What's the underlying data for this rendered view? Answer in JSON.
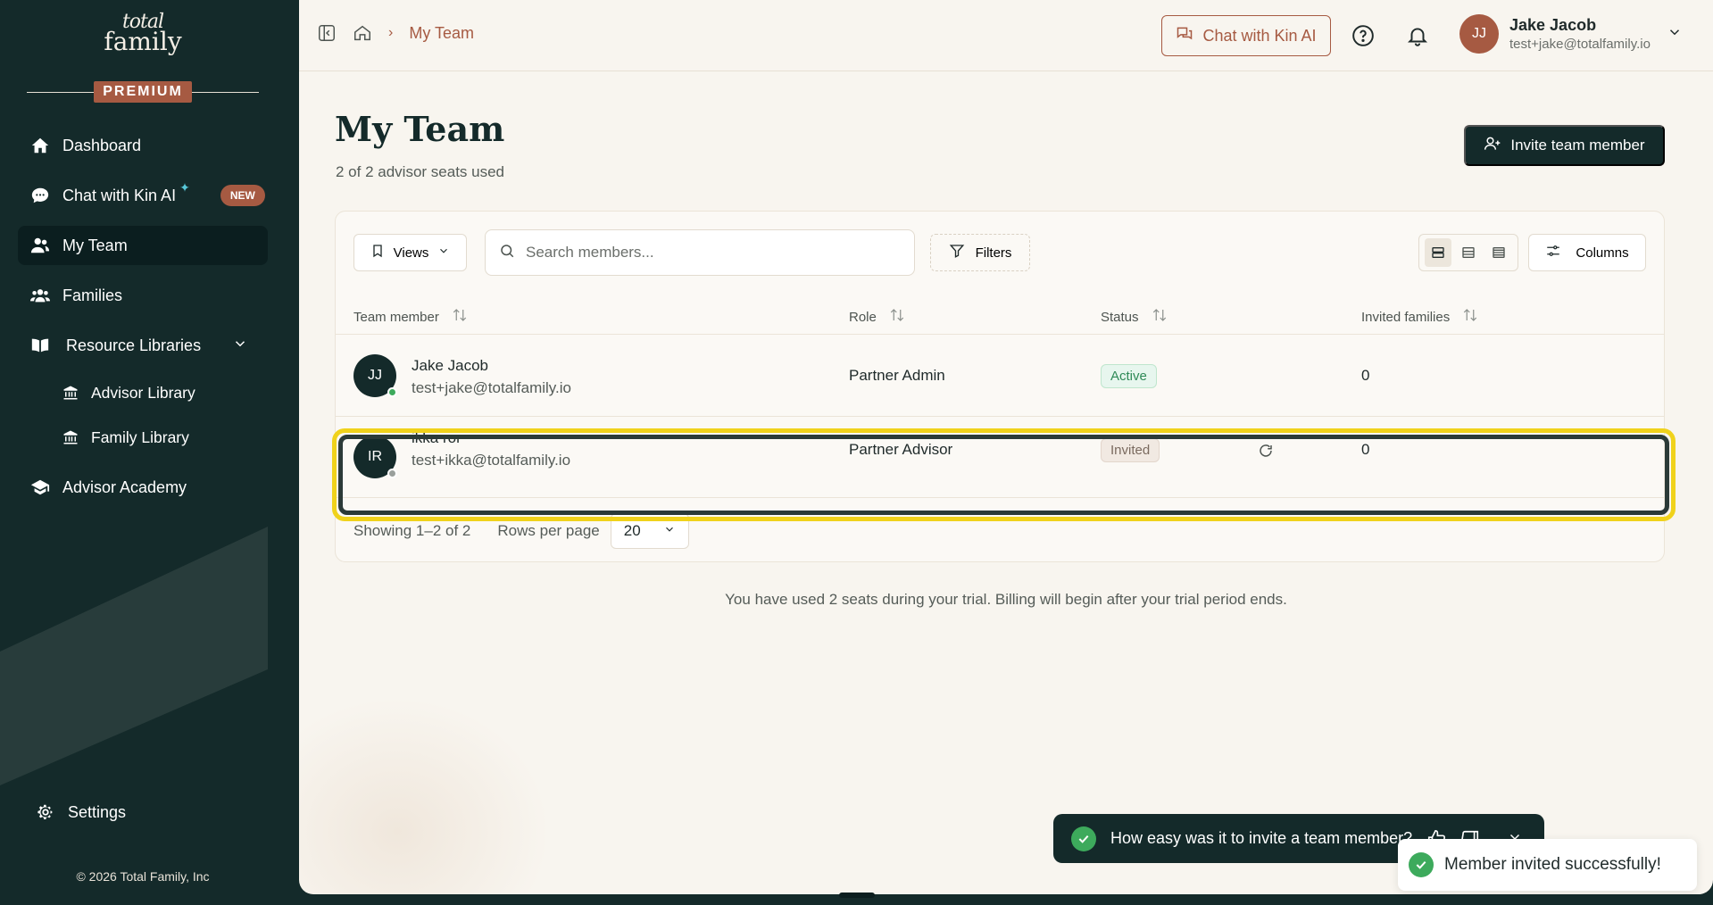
{
  "sidebar": {
    "logo_top": "total",
    "logo_bottom": "family",
    "plan_badge": "PREMIUM",
    "items": [
      {
        "label": "Dashboard"
      },
      {
        "label": "Chat with Kin AI",
        "badge": "NEW"
      },
      {
        "label": "My Team"
      },
      {
        "label": "Families"
      },
      {
        "label": "Resource Libraries"
      },
      {
        "label": "Advisor Library"
      },
      {
        "label": "Family Library"
      },
      {
        "label": "Advisor Academy"
      }
    ],
    "settings_label": "Settings",
    "copyright": "© 2026 Total Family, Inc"
  },
  "header": {
    "breadcrumb_current": "My Team",
    "chat_button": "Chat with Kin AI",
    "user": {
      "initials": "JJ",
      "name": "Jake Jacob",
      "email": "test+jake@totalfamily.io"
    }
  },
  "page": {
    "title": "My Team",
    "subtitle": "2 of 2 advisor seats used",
    "invite_button": "Invite team member"
  },
  "toolbar": {
    "views_label": "Views",
    "search_placeholder": "Search members...",
    "filters_label": "Filters",
    "columns_label": "Columns"
  },
  "table": {
    "headers": [
      "Team member",
      "Role",
      "Status",
      "Invited families"
    ],
    "rows": [
      {
        "initials": "JJ",
        "name": "Jake Jacob",
        "email": "test+jake@totalfamily.io",
        "role": "Partner Admin",
        "status": "Active",
        "families": "0"
      },
      {
        "initials": "IR",
        "name": "ikka ror",
        "email": "test+ikka@totalfamily.io",
        "role": "Partner Advisor",
        "status": "Invited",
        "families": "0"
      }
    ]
  },
  "pagination": {
    "showing": "Showing 1–2 of 2",
    "rows_per_page_label": "Rows per page",
    "rows_per_page_value": "20"
  },
  "trial_note": "You have used 2 seats during your trial. Billing will begin after your trial period ends.",
  "feedback": {
    "question": "How easy was it to invite a team member?"
  },
  "toast": {
    "message": "Member invited successfully!"
  },
  "colors": {
    "sidebar_bg": "#142a2a",
    "accent": "#a65a42",
    "success": "#3daa5c",
    "highlight": "#f0d21b"
  }
}
